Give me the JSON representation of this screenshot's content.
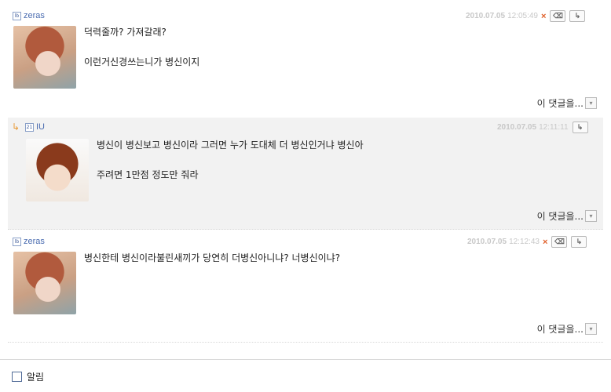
{
  "comments": [
    {
      "author": "zeras",
      "level_icon": "lb",
      "date": "2010.07.05",
      "time": "12:05:49",
      "lines": [
        "덕력줄까? 가져갈래?",
        "이런거신경쓰는니가 병신이지"
      ],
      "more_label": "이 댓글을...",
      "delete": "×",
      "edit": "⌫",
      "reply": "↳"
    },
    {
      "author": "IU",
      "level_icon": "21",
      "reply_arrow": "↳",
      "date": "2010.07.05",
      "time": "12:11:11",
      "lines": [
        "병신이 병신보고 병신이라 그러면 누가 도대체 더 병신인거냐 병신아",
        "주려면 1만점 정도만 줘라"
      ],
      "more_label": "이 댓글을...",
      "reply": "↳"
    },
    {
      "author": "zeras",
      "level_icon": "lb",
      "date": "2010.07.05",
      "time": "12:12:43",
      "lines": [
        "병신한테 병신이라불린새끼가 당연히 더병신아니냐? 너병신이냐?"
      ],
      "more_label": "이 댓글을...",
      "delete": "×",
      "edit": "⌫",
      "reply": "↳"
    }
  ],
  "notify": {
    "label": "알림"
  }
}
